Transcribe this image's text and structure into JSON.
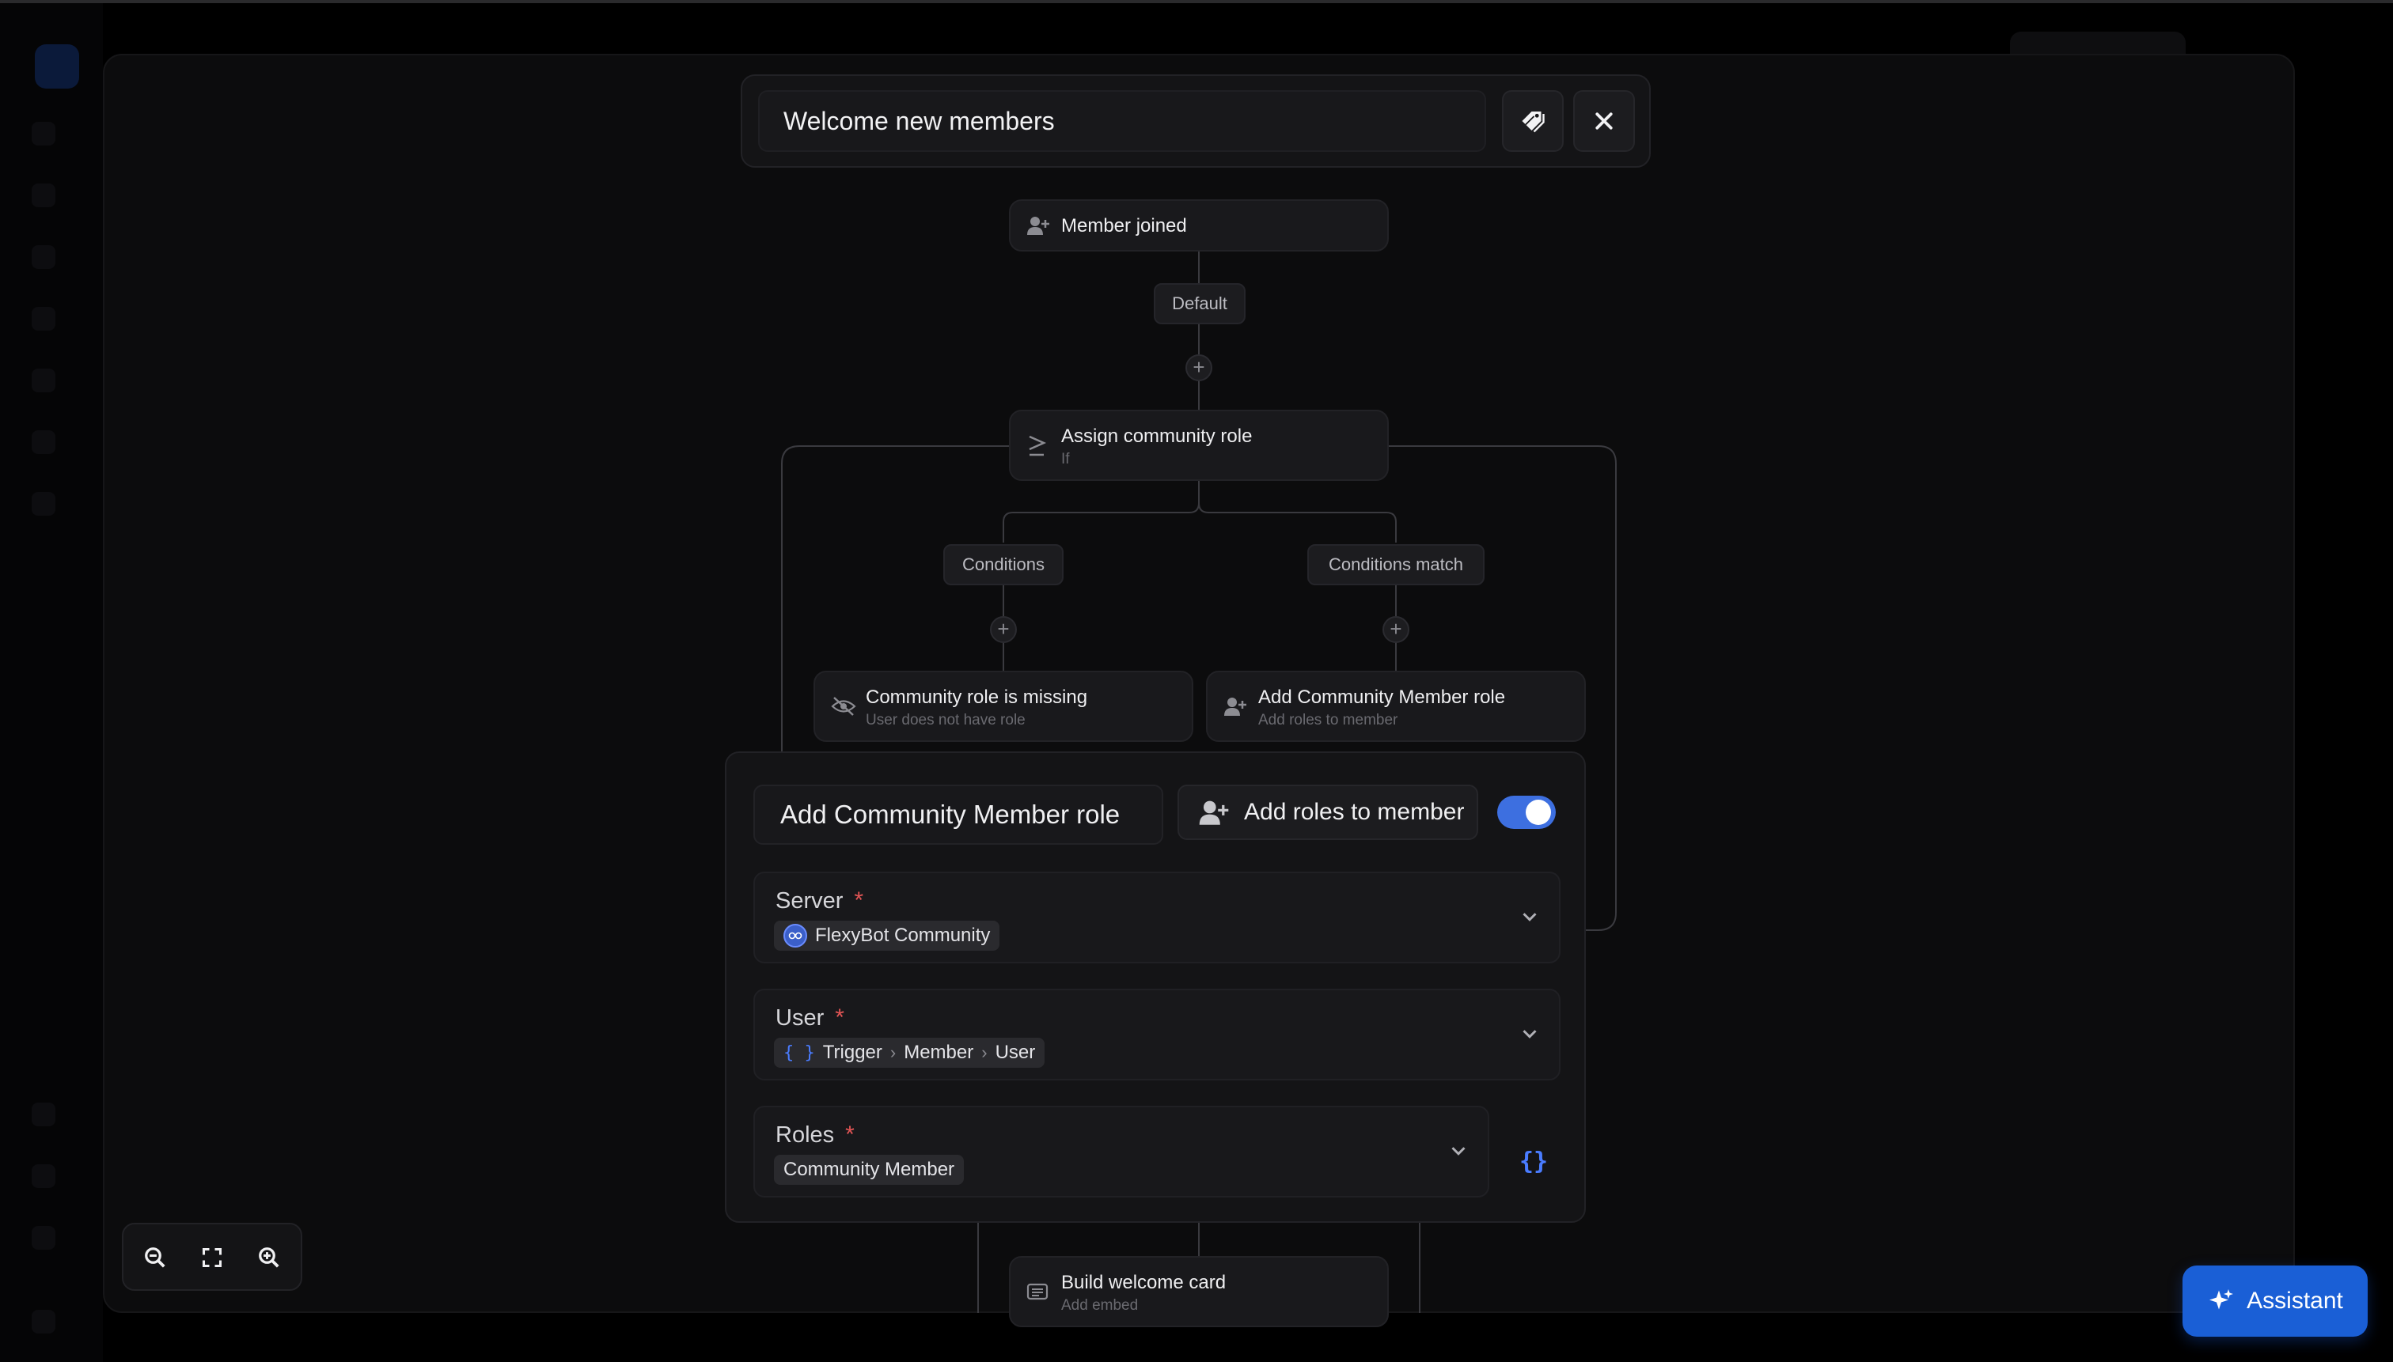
{
  "workflow": {
    "title": "Welcome new members"
  },
  "header": {
    "tag_icon": "tag-icon",
    "close_icon": "close-icon"
  },
  "flow": {
    "trigger": {
      "title": "Member joined",
      "icon": "user-plus-icon"
    },
    "default_label": "Default",
    "condition": {
      "title": "Assign community role",
      "subtitle": "If",
      "icon": "greater-equal-icon"
    },
    "branch_left_label": "Conditions",
    "branch_right_label": "Conditions match",
    "left_node": {
      "title": "Community role is missing",
      "subtitle": "User does not have role",
      "icon": "eye-off-icon"
    },
    "right_node": {
      "title": "Add Community Member role",
      "subtitle": "Add roles to member",
      "icon": "user-plus-icon"
    },
    "bottom_node": {
      "title": "Build welcome card",
      "subtitle": "Add embed",
      "icon": "card-icon"
    }
  },
  "panel": {
    "name": "Add Community Member role",
    "action_label": "Add roles to member",
    "enabled": true,
    "fields": {
      "server": {
        "label": "Server",
        "required_mark": "*",
        "value": "FlexyBot Community"
      },
      "user": {
        "label": "User",
        "required_mark": "*",
        "path": [
          "Trigger",
          "Member",
          "User"
        ]
      },
      "roles": {
        "label": "Roles",
        "required_mark": "*",
        "value": "Community Member"
      }
    }
  },
  "assistant": {
    "label": "Assistant"
  },
  "colors": {
    "accent": "#1a5fd6",
    "toggle": "#3d6fe0",
    "required": "#e25555",
    "background": "#0c0c0d"
  }
}
